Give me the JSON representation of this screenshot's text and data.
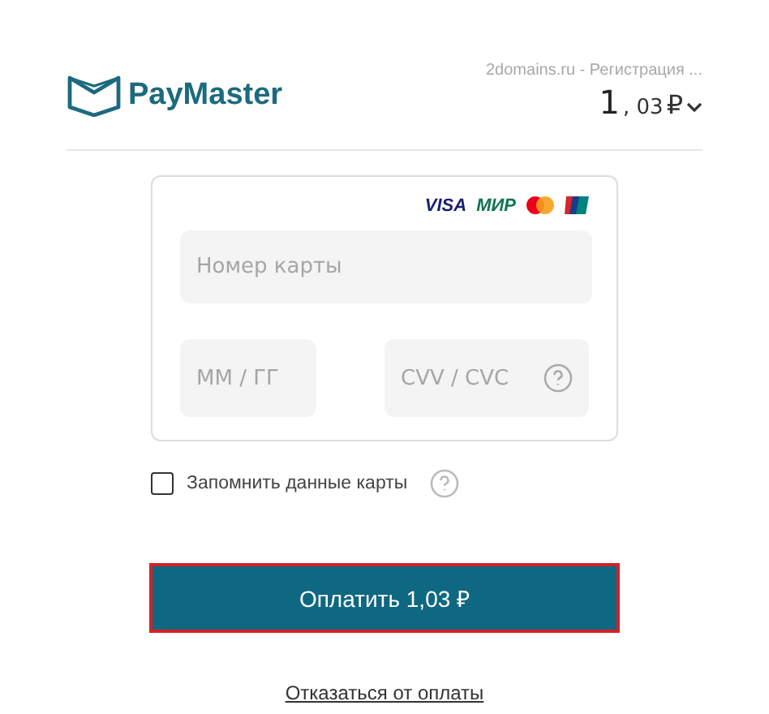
{
  "header": {
    "brand": "PayMaster",
    "merchant": "2domains.ru - Регистрация ...",
    "amount_integer": "1",
    "amount_fraction": ", 03",
    "currency": "₽"
  },
  "card_form": {
    "brands": [
      {
        "kind": "text",
        "label": "VISA",
        "color": "#1a1f71"
      },
      {
        "kind": "text",
        "label": "МИР",
        "color": "#0f754e"
      },
      {
        "kind": "mastercard"
      },
      {
        "kind": "unionpay"
      }
    ],
    "card_number": {
      "placeholder": "Номер карты"
    },
    "expiry": {
      "placeholder": "ММ / ГГ"
    },
    "cvv": {
      "placeholder": "CVV / CVC"
    }
  },
  "remember": {
    "label": "Запомнить данные карты",
    "checked": false
  },
  "pay_button": {
    "label": "Оплатить 1,03 ₽"
  },
  "cancel_link": {
    "label": "Отказаться от оплаты"
  }
}
